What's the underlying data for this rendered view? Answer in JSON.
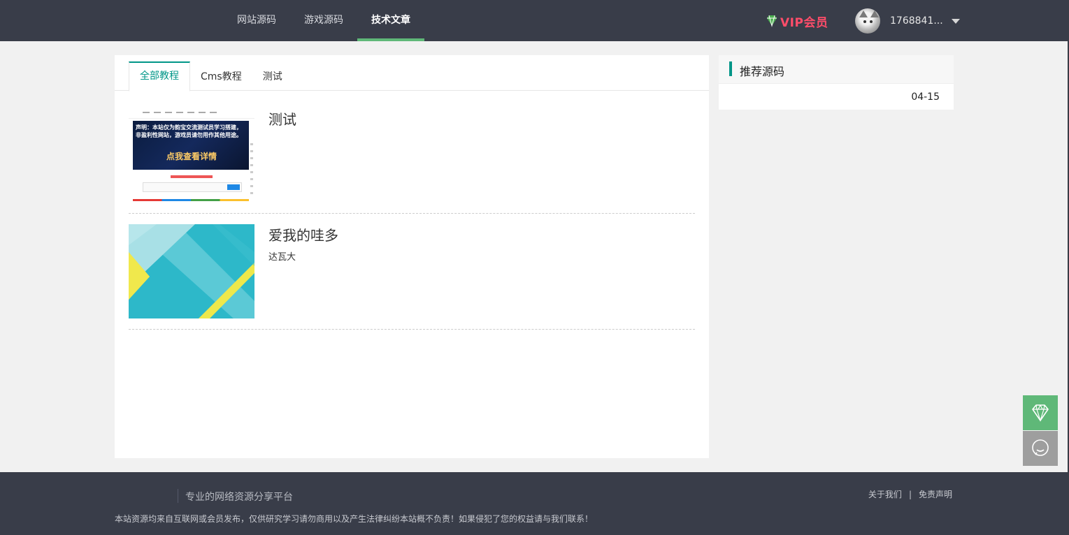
{
  "header": {
    "nav": [
      {
        "label": "网站源码"
      },
      {
        "label": "游戏源码"
      },
      {
        "label": "技术文章",
        "active": true
      }
    ],
    "vip_label": "VIP会员",
    "username": "1768841..."
  },
  "tabs": [
    {
      "label": "全部教程",
      "active": true
    },
    {
      "label": "Cms教程"
    },
    {
      "label": "测试"
    }
  ],
  "articles": [
    {
      "title": "测试",
      "desc": "",
      "thumb_text": "声明：本站仅为韵宝交流测试员学习搭建，非盈利性网站，游戏员请勿用作其他用途。",
      "thumb_cta": "点我查看详情"
    },
    {
      "title": "爱我的哇多",
      "desc": "达瓦大"
    }
  ],
  "sidebar": {
    "title": "推荐源码",
    "items": [
      {
        "date": "04-15"
      }
    ]
  },
  "footer": {
    "slogan": "专业的网络资源分享平台",
    "disclaimer": "本站资源均来自互联网或会员发布，仅供研究学习请勿商用以及产生法律纠纷本站概不负责！如果侵犯了您的权益请与我们联系！",
    "links": [
      "关于我们",
      "免责声明"
    ]
  },
  "colors": {
    "header_bg": "#393d49",
    "accent": "#5fb878",
    "tab_accent": "#009688",
    "vip": "#ff4d6a"
  },
  "icons": [
    "diamond-icon",
    "chat-icon",
    "caret-down-icon"
  ]
}
